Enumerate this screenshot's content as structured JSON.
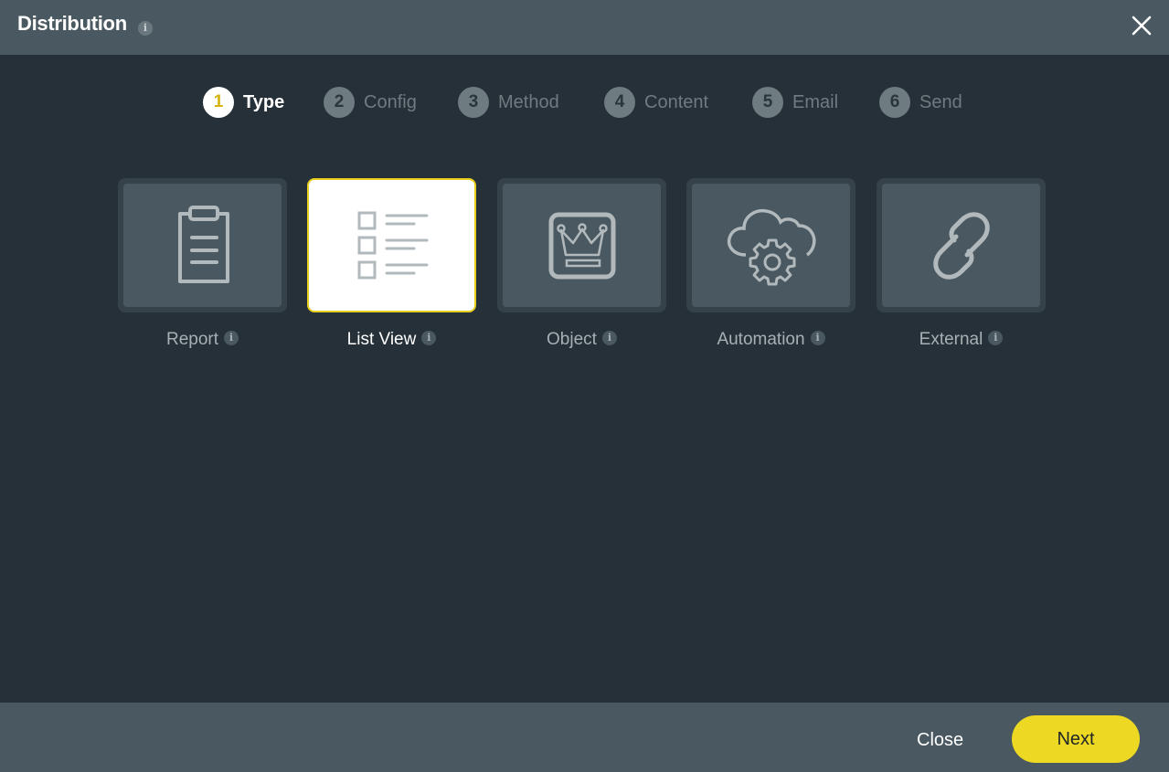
{
  "header": {
    "title": "Distribution",
    "info_glyph": "i",
    "close_icon": "close-icon"
  },
  "steps": [
    {
      "number": "1",
      "label": "Type",
      "active": true
    },
    {
      "number": "2",
      "label": "Config",
      "active": false
    },
    {
      "number": "3",
      "label": "Method",
      "active": false
    },
    {
      "number": "4",
      "label": "Content",
      "active": false
    },
    {
      "number": "5",
      "label": "Email",
      "active": false
    },
    {
      "number": "6",
      "label": "Send",
      "active": false
    }
  ],
  "types": [
    {
      "label": "Report",
      "icon": "clipboard-icon",
      "selected": false
    },
    {
      "label": "List View",
      "icon": "checklist-icon",
      "selected": true
    },
    {
      "label": "Object",
      "icon": "crown-icon",
      "selected": false
    },
    {
      "label": "Automation",
      "icon": "cloud-gear-icon",
      "selected": false
    },
    {
      "label": "External",
      "icon": "link-icon",
      "selected": false
    }
  ],
  "footer": {
    "close_label": "Close",
    "next_label": "Next"
  },
  "colors": {
    "accent": "#edd823",
    "header_bg": "#4a5961",
    "body_bg": "#263038",
    "active_step_number": "#d6b40c"
  }
}
